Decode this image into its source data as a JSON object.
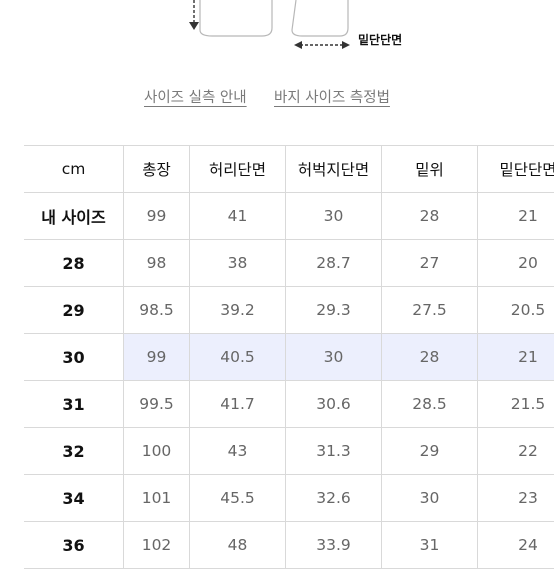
{
  "diagram": {
    "hem_label": "밑단단면"
  },
  "links": {
    "size_guide": "사이즈 실측 안내",
    "pants_measure": "바지 사이즈 측정법"
  },
  "table": {
    "header": [
      "cm",
      "총장",
      "허리단면",
      "허벅지단면",
      "밑위",
      "밑단단면"
    ],
    "rows": [
      {
        "label": "내 사이즈",
        "values": [
          "99",
          "41",
          "30",
          "28",
          "21"
        ]
      },
      {
        "label": "28",
        "values": [
          "98",
          "38",
          "28.7",
          "27",
          "20"
        ]
      },
      {
        "label": "29",
        "values": [
          "98.5",
          "39.2",
          "29.3",
          "27.5",
          "20.5"
        ]
      },
      {
        "label": "30",
        "values": [
          "99",
          "40.5",
          "30",
          "28",
          "21"
        ],
        "highlighted": true
      },
      {
        "label": "31",
        "values": [
          "99.5",
          "41.7",
          "30.6",
          "28.5",
          "21.5"
        ]
      },
      {
        "label": "32",
        "values": [
          "100",
          "43",
          "31.3",
          "29",
          "22"
        ]
      },
      {
        "label": "34",
        "values": [
          "101",
          "45.5",
          "32.6",
          "30",
          "23"
        ]
      },
      {
        "label": "36",
        "values": [
          "102",
          "48",
          "33.9",
          "31",
          "24"
        ]
      }
    ],
    "highlight_color": "#eceffd"
  }
}
